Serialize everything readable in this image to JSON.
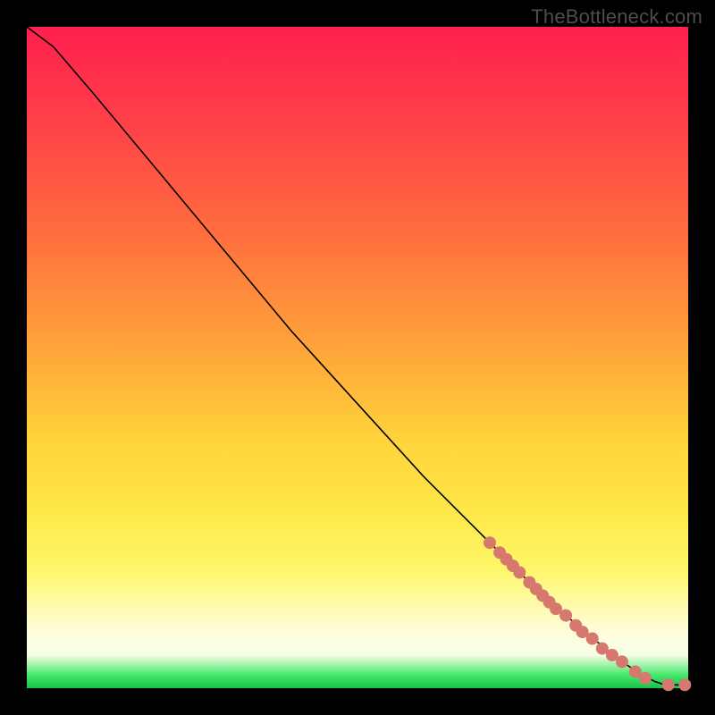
{
  "watermark": "TheBottleneck.com",
  "colors": {
    "curve_stroke": "#000000",
    "marker_fill": "#d6786e",
    "marker_stroke": "#b85a52"
  },
  "chart_data": {
    "type": "line",
    "title": "",
    "xlabel": "",
    "ylabel": "",
    "xlim": [
      0,
      100
    ],
    "ylim": [
      0,
      100
    ],
    "series": [
      {
        "name": "curve",
        "x": [
          0,
          4,
          10,
          20,
          30,
          40,
          50,
          60,
          70,
          78,
          85,
          90,
          93,
          95,
          96.5,
          98,
          100
        ],
        "y": [
          100,
          97,
          90,
          78,
          66,
          54,
          43,
          32,
          22,
          14,
          8,
          4,
          2,
          1,
          0.5,
          0.5,
          0.5
        ]
      }
    ],
    "markers": {
      "name": "highlighted-points",
      "x": [
        70,
        71.5,
        72.5,
        73.5,
        74.5,
        76,
        77,
        78,
        79,
        80,
        81.5,
        83,
        84,
        85.5,
        87,
        88.5,
        90,
        92,
        93.5,
        97,
        99.5
      ],
      "y": [
        22,
        20.5,
        19.5,
        18.5,
        17.5,
        16,
        15,
        14,
        13,
        12,
        11,
        9.5,
        8.5,
        7.5,
        6,
        5,
        4,
        2.5,
        1.5,
        0.5,
        0.5
      ]
    }
  }
}
